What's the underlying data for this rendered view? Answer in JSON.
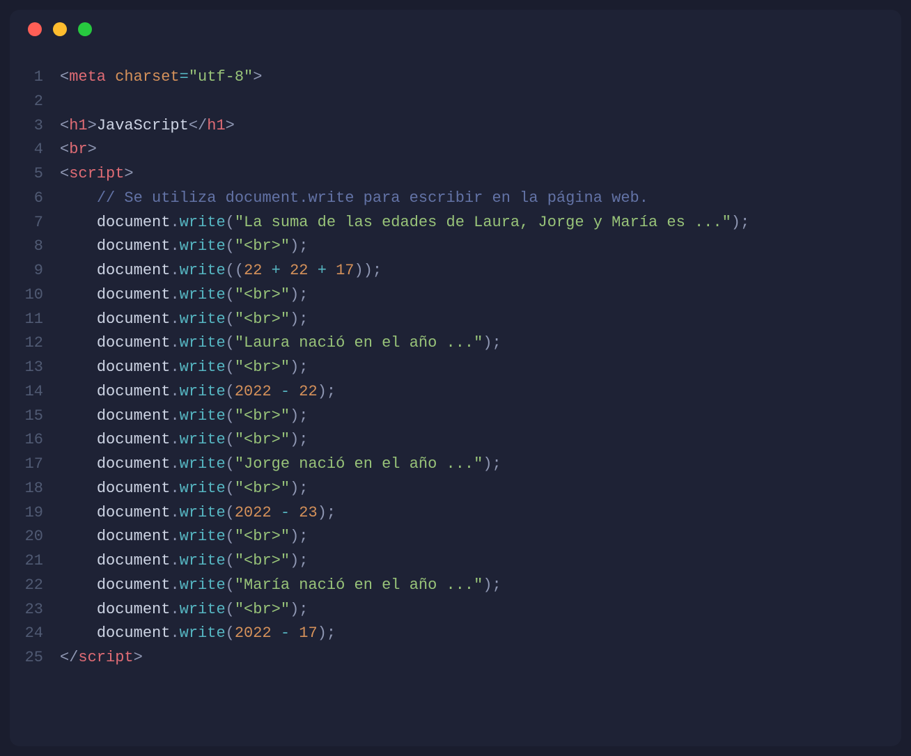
{
  "code": {
    "lines": [
      {
        "n": "1",
        "indent": 0,
        "tokens": [
          {
            "c": "tok-punct",
            "t": "<"
          },
          {
            "c": "tok-tag",
            "t": "meta"
          },
          {
            "c": "tok-default",
            "t": " "
          },
          {
            "c": "tok-attr",
            "t": "charset"
          },
          {
            "c": "tok-op",
            "t": "="
          },
          {
            "c": "tok-str",
            "t": "\"utf-8\""
          },
          {
            "c": "tok-punct",
            "t": ">"
          }
        ]
      },
      {
        "n": "2",
        "indent": 0,
        "tokens": []
      },
      {
        "n": "3",
        "indent": 0,
        "tokens": [
          {
            "c": "tok-punct",
            "t": "<"
          },
          {
            "c": "tok-tag",
            "t": "h1"
          },
          {
            "c": "tok-punct",
            "t": ">"
          },
          {
            "c": "tok-default",
            "t": "JavaScript"
          },
          {
            "c": "tok-punct",
            "t": "</"
          },
          {
            "c": "tok-tag",
            "t": "h1"
          },
          {
            "c": "tok-punct",
            "t": ">"
          }
        ]
      },
      {
        "n": "4",
        "indent": 0,
        "tokens": [
          {
            "c": "tok-punct",
            "t": "<"
          },
          {
            "c": "tok-tag",
            "t": "br"
          },
          {
            "c": "tok-punct",
            "t": ">"
          }
        ]
      },
      {
        "n": "5",
        "indent": 0,
        "tokens": [
          {
            "c": "tok-punct",
            "t": "<"
          },
          {
            "c": "tok-tag",
            "t": "script"
          },
          {
            "c": "tok-punct",
            "t": ">"
          }
        ]
      },
      {
        "n": "6",
        "indent": 1,
        "tokens": [
          {
            "c": "tok-comment",
            "t": "// Se utiliza document.write para escribir en la página web."
          }
        ]
      },
      {
        "n": "7",
        "indent": 1,
        "tokens": [
          {
            "c": "tok-default",
            "t": "document"
          },
          {
            "c": "tok-dot",
            "t": "."
          },
          {
            "c": "tok-func",
            "t": "write"
          },
          {
            "c": "tok-punct",
            "t": "("
          },
          {
            "c": "tok-str",
            "t": "\"La suma de las edades de Laura, Jorge y María es ...\""
          },
          {
            "c": "tok-punct",
            "t": ")"
          },
          {
            "c": "tok-punct",
            "t": ";"
          }
        ]
      },
      {
        "n": "8",
        "indent": 1,
        "tokens": [
          {
            "c": "tok-default",
            "t": "document"
          },
          {
            "c": "tok-dot",
            "t": "."
          },
          {
            "c": "tok-func",
            "t": "write"
          },
          {
            "c": "tok-punct",
            "t": "("
          },
          {
            "c": "tok-str",
            "t": "\"<br>\""
          },
          {
            "c": "tok-punct",
            "t": ")"
          },
          {
            "c": "tok-punct",
            "t": ";"
          }
        ]
      },
      {
        "n": "9",
        "indent": 1,
        "tokens": [
          {
            "c": "tok-default",
            "t": "document"
          },
          {
            "c": "tok-dot",
            "t": "."
          },
          {
            "c": "tok-func",
            "t": "write"
          },
          {
            "c": "tok-punct",
            "t": "(("
          },
          {
            "c": "tok-num",
            "t": "22"
          },
          {
            "c": "tok-default",
            "t": " "
          },
          {
            "c": "tok-op",
            "t": "+"
          },
          {
            "c": "tok-default",
            "t": " "
          },
          {
            "c": "tok-num",
            "t": "22"
          },
          {
            "c": "tok-default",
            "t": " "
          },
          {
            "c": "tok-op",
            "t": "+"
          },
          {
            "c": "tok-default",
            "t": " "
          },
          {
            "c": "tok-num",
            "t": "17"
          },
          {
            "c": "tok-punct",
            "t": "))"
          },
          {
            "c": "tok-punct",
            "t": ";"
          }
        ]
      },
      {
        "n": "10",
        "indent": 1,
        "tokens": [
          {
            "c": "tok-default",
            "t": "document"
          },
          {
            "c": "tok-dot",
            "t": "."
          },
          {
            "c": "tok-func",
            "t": "write"
          },
          {
            "c": "tok-punct",
            "t": "("
          },
          {
            "c": "tok-str",
            "t": "\"<br>\""
          },
          {
            "c": "tok-punct",
            "t": ")"
          },
          {
            "c": "tok-punct",
            "t": ";"
          }
        ]
      },
      {
        "n": "11",
        "indent": 1,
        "tokens": [
          {
            "c": "tok-default",
            "t": "document"
          },
          {
            "c": "tok-dot",
            "t": "."
          },
          {
            "c": "tok-func",
            "t": "write"
          },
          {
            "c": "tok-punct",
            "t": "("
          },
          {
            "c": "tok-str",
            "t": "\"<br>\""
          },
          {
            "c": "tok-punct",
            "t": ")"
          },
          {
            "c": "tok-punct",
            "t": ";"
          }
        ]
      },
      {
        "n": "12",
        "indent": 1,
        "tokens": [
          {
            "c": "tok-default",
            "t": "document"
          },
          {
            "c": "tok-dot",
            "t": "."
          },
          {
            "c": "tok-func",
            "t": "write"
          },
          {
            "c": "tok-punct",
            "t": "("
          },
          {
            "c": "tok-str",
            "t": "\"Laura nació en el año ...\""
          },
          {
            "c": "tok-punct",
            "t": ")"
          },
          {
            "c": "tok-punct",
            "t": ";"
          }
        ]
      },
      {
        "n": "13",
        "indent": 1,
        "tokens": [
          {
            "c": "tok-default",
            "t": "document"
          },
          {
            "c": "tok-dot",
            "t": "."
          },
          {
            "c": "tok-func",
            "t": "write"
          },
          {
            "c": "tok-punct",
            "t": "("
          },
          {
            "c": "tok-str",
            "t": "\"<br>\""
          },
          {
            "c": "tok-punct",
            "t": ")"
          },
          {
            "c": "tok-punct",
            "t": ";"
          }
        ]
      },
      {
        "n": "14",
        "indent": 1,
        "tokens": [
          {
            "c": "tok-default",
            "t": "document"
          },
          {
            "c": "tok-dot",
            "t": "."
          },
          {
            "c": "tok-func",
            "t": "write"
          },
          {
            "c": "tok-punct",
            "t": "("
          },
          {
            "c": "tok-num",
            "t": "2022"
          },
          {
            "c": "tok-default",
            "t": " "
          },
          {
            "c": "tok-op",
            "t": "-"
          },
          {
            "c": "tok-default",
            "t": " "
          },
          {
            "c": "tok-num",
            "t": "22"
          },
          {
            "c": "tok-punct",
            "t": ")"
          },
          {
            "c": "tok-punct",
            "t": ";"
          }
        ]
      },
      {
        "n": "15",
        "indent": 1,
        "tokens": [
          {
            "c": "tok-default",
            "t": "document"
          },
          {
            "c": "tok-dot",
            "t": "."
          },
          {
            "c": "tok-func",
            "t": "write"
          },
          {
            "c": "tok-punct",
            "t": "("
          },
          {
            "c": "tok-str",
            "t": "\"<br>\""
          },
          {
            "c": "tok-punct",
            "t": ")"
          },
          {
            "c": "tok-punct",
            "t": ";"
          }
        ]
      },
      {
        "n": "16",
        "indent": 1,
        "tokens": [
          {
            "c": "tok-default",
            "t": "document"
          },
          {
            "c": "tok-dot",
            "t": "."
          },
          {
            "c": "tok-func",
            "t": "write"
          },
          {
            "c": "tok-punct",
            "t": "("
          },
          {
            "c": "tok-str",
            "t": "\"<br>\""
          },
          {
            "c": "tok-punct",
            "t": ")"
          },
          {
            "c": "tok-punct",
            "t": ";"
          }
        ]
      },
      {
        "n": "17",
        "indent": 1,
        "tokens": [
          {
            "c": "tok-default",
            "t": "document"
          },
          {
            "c": "tok-dot",
            "t": "."
          },
          {
            "c": "tok-func",
            "t": "write"
          },
          {
            "c": "tok-punct",
            "t": "("
          },
          {
            "c": "tok-str",
            "t": "\"Jorge nació en el año ...\""
          },
          {
            "c": "tok-punct",
            "t": ")"
          },
          {
            "c": "tok-punct",
            "t": ";"
          }
        ]
      },
      {
        "n": "18",
        "indent": 1,
        "tokens": [
          {
            "c": "tok-default",
            "t": "document"
          },
          {
            "c": "tok-dot",
            "t": "."
          },
          {
            "c": "tok-func",
            "t": "write"
          },
          {
            "c": "tok-punct",
            "t": "("
          },
          {
            "c": "tok-str",
            "t": "\"<br>\""
          },
          {
            "c": "tok-punct",
            "t": ")"
          },
          {
            "c": "tok-punct",
            "t": ";"
          }
        ]
      },
      {
        "n": "19",
        "indent": 1,
        "tokens": [
          {
            "c": "tok-default",
            "t": "document"
          },
          {
            "c": "tok-dot",
            "t": "."
          },
          {
            "c": "tok-func",
            "t": "write"
          },
          {
            "c": "tok-punct",
            "t": "("
          },
          {
            "c": "tok-num",
            "t": "2022"
          },
          {
            "c": "tok-default",
            "t": " "
          },
          {
            "c": "tok-op",
            "t": "-"
          },
          {
            "c": "tok-default",
            "t": " "
          },
          {
            "c": "tok-num",
            "t": "23"
          },
          {
            "c": "tok-punct",
            "t": ")"
          },
          {
            "c": "tok-punct",
            "t": ";"
          }
        ]
      },
      {
        "n": "20",
        "indent": 1,
        "tokens": [
          {
            "c": "tok-default",
            "t": "document"
          },
          {
            "c": "tok-dot",
            "t": "."
          },
          {
            "c": "tok-func",
            "t": "write"
          },
          {
            "c": "tok-punct",
            "t": "("
          },
          {
            "c": "tok-str",
            "t": "\"<br>\""
          },
          {
            "c": "tok-punct",
            "t": ")"
          },
          {
            "c": "tok-punct",
            "t": ";"
          }
        ]
      },
      {
        "n": "21",
        "indent": 1,
        "tokens": [
          {
            "c": "tok-default",
            "t": "document"
          },
          {
            "c": "tok-dot",
            "t": "."
          },
          {
            "c": "tok-func",
            "t": "write"
          },
          {
            "c": "tok-punct",
            "t": "("
          },
          {
            "c": "tok-str",
            "t": "\"<br>\""
          },
          {
            "c": "tok-punct",
            "t": ")"
          },
          {
            "c": "tok-punct",
            "t": ";"
          }
        ]
      },
      {
        "n": "22",
        "indent": 1,
        "tokens": [
          {
            "c": "tok-default",
            "t": "document"
          },
          {
            "c": "tok-dot",
            "t": "."
          },
          {
            "c": "tok-func",
            "t": "write"
          },
          {
            "c": "tok-punct",
            "t": "("
          },
          {
            "c": "tok-str",
            "t": "\"María nació en el año ...\""
          },
          {
            "c": "tok-punct",
            "t": ")"
          },
          {
            "c": "tok-punct",
            "t": ";"
          }
        ]
      },
      {
        "n": "23",
        "indent": 1,
        "tokens": [
          {
            "c": "tok-default",
            "t": "document"
          },
          {
            "c": "tok-dot",
            "t": "."
          },
          {
            "c": "tok-func",
            "t": "write"
          },
          {
            "c": "tok-punct",
            "t": "("
          },
          {
            "c": "tok-str",
            "t": "\"<br>\""
          },
          {
            "c": "tok-punct",
            "t": ")"
          },
          {
            "c": "tok-punct",
            "t": ";"
          }
        ]
      },
      {
        "n": "24",
        "indent": 1,
        "tokens": [
          {
            "c": "tok-default",
            "t": "document"
          },
          {
            "c": "tok-dot",
            "t": "."
          },
          {
            "c": "tok-func",
            "t": "write"
          },
          {
            "c": "tok-punct",
            "t": "("
          },
          {
            "c": "tok-num",
            "t": "2022"
          },
          {
            "c": "tok-default",
            "t": " "
          },
          {
            "c": "tok-op",
            "t": "-"
          },
          {
            "c": "tok-default",
            "t": " "
          },
          {
            "c": "tok-num",
            "t": "17"
          },
          {
            "c": "tok-punct",
            "t": ")"
          },
          {
            "c": "tok-punct",
            "t": ";"
          }
        ]
      },
      {
        "n": "25",
        "indent": 0,
        "tokens": [
          {
            "c": "tok-punct",
            "t": "</"
          },
          {
            "c": "tok-tag",
            "t": "script"
          },
          {
            "c": "tok-punct",
            "t": ">"
          }
        ]
      }
    ]
  }
}
